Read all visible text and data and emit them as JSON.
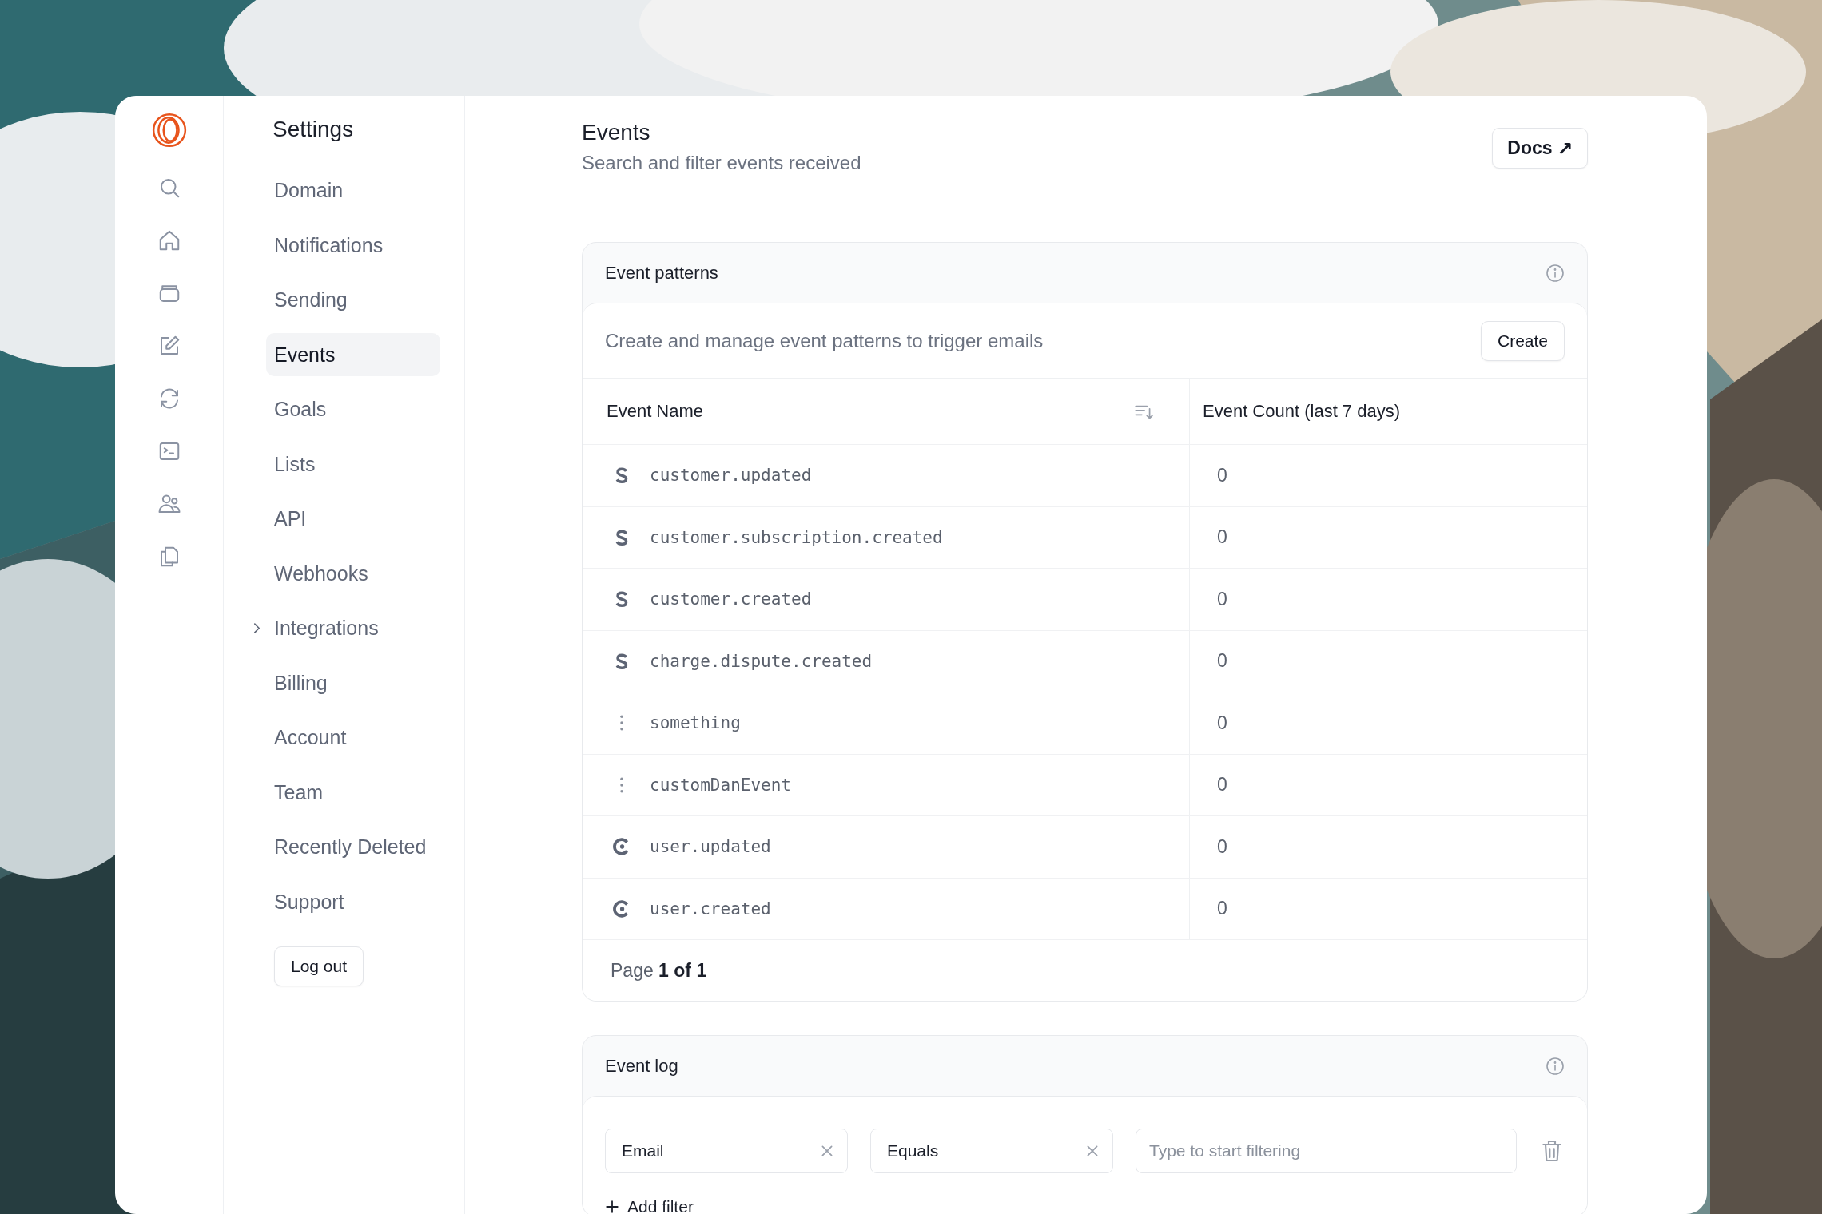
{
  "settings_nav": {
    "title": "Settings",
    "items": [
      {
        "label": "Domain",
        "selected": false
      },
      {
        "label": "Notifications",
        "selected": false
      },
      {
        "label": "Sending",
        "selected": false
      },
      {
        "label": "Events",
        "selected": true
      },
      {
        "label": "Goals",
        "selected": false
      },
      {
        "label": "Lists",
        "selected": false
      },
      {
        "label": "API",
        "selected": false
      },
      {
        "label": "Webhooks",
        "selected": false
      },
      {
        "label": "Integrations",
        "selected": false,
        "expanded": false
      },
      {
        "label": "Billing",
        "selected": false
      },
      {
        "label": "Account",
        "selected": false
      },
      {
        "label": "Team",
        "selected": false
      },
      {
        "label": "Recently Deleted",
        "selected": false
      },
      {
        "label": "Support",
        "selected": false
      }
    ],
    "logout_button": "Log out"
  },
  "header": {
    "title": "Events",
    "subtitle": "Search and filter events received",
    "docs_button": "Docs ↗"
  },
  "event_patterns": {
    "title": "Event patterns",
    "description": "Create and manage event patterns to trigger emails",
    "create_button": "Create",
    "columns": [
      "Event Name",
      "Event Count (last 7 days)"
    ],
    "rows": [
      {
        "kind": "stripe",
        "name": "customer.updated",
        "count": "0"
      },
      {
        "kind": "stripe",
        "name": "customer.subscription.created",
        "count": "0"
      },
      {
        "kind": "stripe",
        "name": "customer.created",
        "count": "0"
      },
      {
        "kind": "stripe",
        "name": "charge.dispute.created",
        "count": "0"
      },
      {
        "kind": "custom",
        "name": "something",
        "count": "0"
      },
      {
        "kind": "custom",
        "name": "customDanEvent",
        "count": "0"
      },
      {
        "kind": "clerk",
        "name": "user.updated",
        "count": "0"
      },
      {
        "kind": "clerk",
        "name": "user.created",
        "count": "0"
      }
    ],
    "pagination": "Page **1 of 1**"
  },
  "event_log": {
    "title": "Event log",
    "filters": [
      {
        "value": "Email"
      },
      {
        "value": "Equals"
      }
    ],
    "search": {
      "placeholder": "Type to start filtering"
    },
    "add_filter": "Add filter"
  }
}
